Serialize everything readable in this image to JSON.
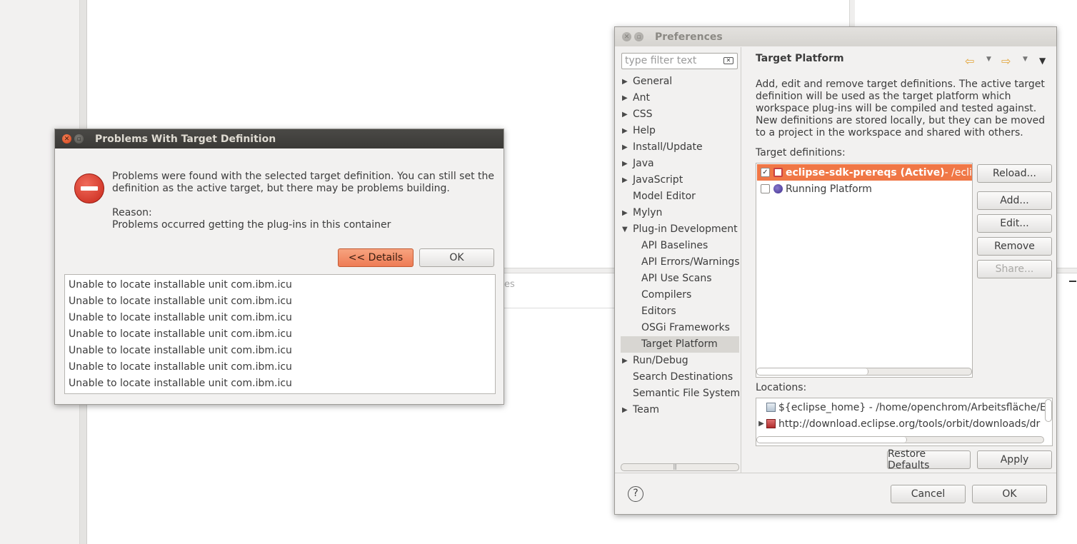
{
  "background": {
    "partial_tab_text": "es"
  },
  "problems_dialog": {
    "title": "Problems With Target Definition",
    "message_line1": "Problems were found with the selected target definition.  You can still set the",
    "message_line2": "definition as the active target, but there may be problems building.",
    "reason_label": "Reason:",
    "reason_text": "Problems occurred getting the plug-ins in this container",
    "details_button": "<< Details",
    "ok_button": "OK",
    "details": [
      "Unable to locate installable unit com.ibm.icu",
      "Unable to locate installable unit com.ibm.icu",
      "Unable to locate installable unit com.ibm.icu",
      "Unable to locate installable unit com.ibm.icu",
      "Unable to locate installable unit com.ibm.icu",
      "Unable to locate installable unit com.ibm.icu",
      "Unable to locate installable unit com.ibm.icu"
    ]
  },
  "preferences": {
    "title": "Preferences",
    "filter_placeholder": "type filter text",
    "tree": [
      {
        "label": "General"
      },
      {
        "label": "Ant"
      },
      {
        "label": "CSS"
      },
      {
        "label": "Help"
      },
      {
        "label": "Install/Update"
      },
      {
        "label": "Java"
      },
      {
        "label": "JavaScript"
      },
      {
        "label": "Model Editor"
      },
      {
        "label": "Mylyn"
      },
      {
        "label": "Plug-in Development"
      },
      {
        "label": "API Baselines"
      },
      {
        "label": "API Errors/Warnings"
      },
      {
        "label": "API Use Scans"
      },
      {
        "label": "Compilers"
      },
      {
        "label": "Editors"
      },
      {
        "label": "OSGi Frameworks"
      },
      {
        "label": "Target Platform"
      },
      {
        "label": "Run/Debug"
      },
      {
        "label": "Search Destinations"
      },
      {
        "label": "Semantic File System"
      },
      {
        "label": "Team"
      }
    ],
    "page_title": "Target Platform",
    "description": "Add, edit and remove target definitions.  The active target definition will be used as the target platform which workspace plug-ins will be compiled and tested against.  New definitions are stored locally, but they can be moved to a project in the workspace and shared with others.",
    "target_definitions_label": "Target definitions:",
    "targets": [
      {
        "name": "eclipse-sdk-prereqs (Active)",
        "path": " - /eclipse",
        "checked": true
      },
      {
        "name": "Running Platform",
        "path": "",
        "checked": false
      }
    ],
    "buttons": {
      "reload": "Reload...",
      "add": "Add...",
      "edit": "Edit...",
      "remove": "Remove",
      "share": "Share...",
      "restore_defaults": "Restore Defaults",
      "apply": "Apply",
      "cancel": "Cancel",
      "ok": "OK"
    },
    "locations_label": "Locations:",
    "locations": [
      "${eclipse_home} - /home/openchrom/Arbeitsfläche/Ecl",
      "http://download.eclipse.org/tools/orbit/downloads/dr"
    ]
  }
}
